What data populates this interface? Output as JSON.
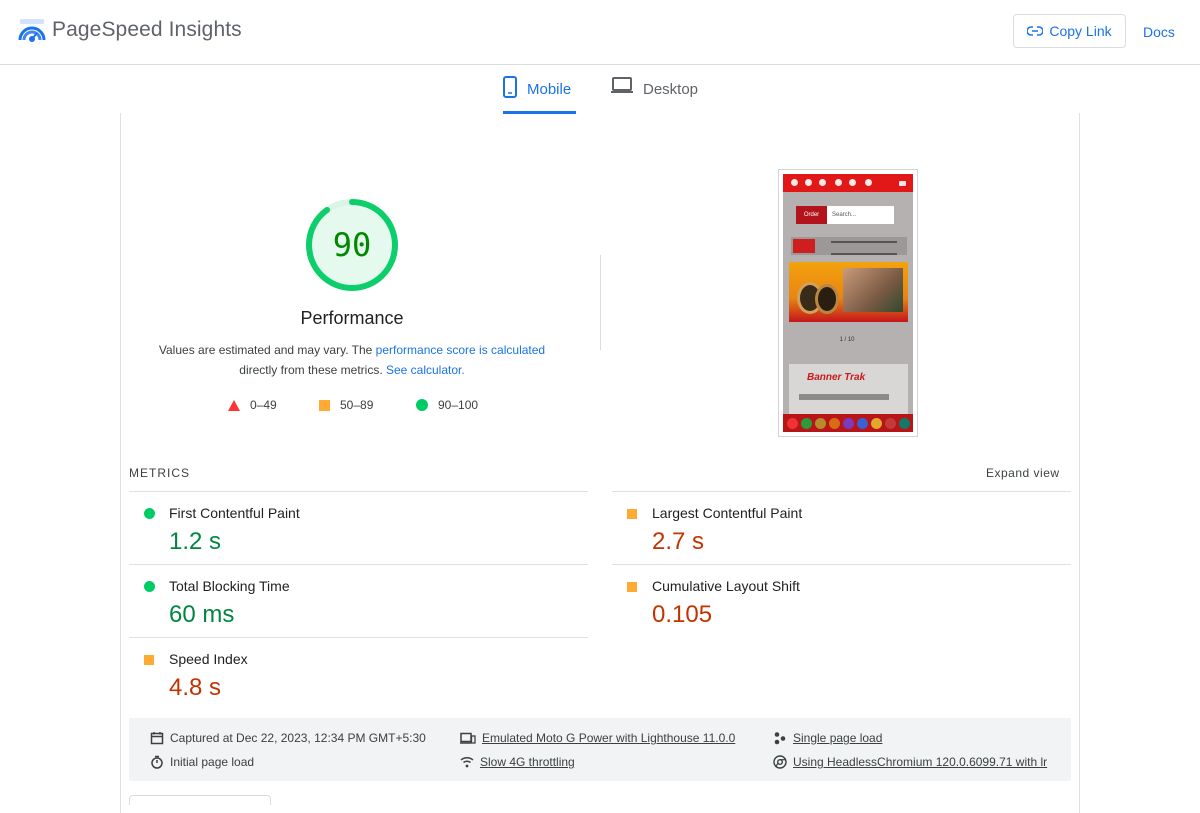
{
  "header": {
    "app_title": "PageSpeed Insights",
    "copy_link_label": "Copy Link",
    "docs_label": "Docs"
  },
  "tabs": [
    {
      "label": "Mobile",
      "selected": true
    },
    {
      "label": "Desktop",
      "selected": false
    }
  ],
  "performance": {
    "score": "90",
    "title": "Performance",
    "desc_prefix": "Values are estimated and may vary. The ",
    "desc_link1": "performance score is calculated",
    "desc_middle": "directly from these metrics. ",
    "desc_link2": "See calculator.",
    "legend": [
      {
        "range": "0–49",
        "shape": "triangle",
        "color": "#ff3333"
      },
      {
        "range": "50–89",
        "shape": "square",
        "color": "#ffaa33"
      },
      {
        "range": "90–100",
        "shape": "circle",
        "color": "#00cc66"
      }
    ]
  },
  "screenshot": {
    "order_label": "Order",
    "search_placeholder": "Search...",
    "pager": "1 / 10",
    "banner_text": "Banner Trak"
  },
  "metrics": {
    "label": "METRICS",
    "expand_label": "Expand view",
    "items": [
      {
        "name": "First Contentful Paint",
        "value": "1.2 s",
        "status": "good"
      },
      {
        "name": "Largest Contentful Paint",
        "value": "2.7 s",
        "status": "average"
      },
      {
        "name": "Total Blocking Time",
        "value": "60 ms",
        "status": "good"
      },
      {
        "name": "Cumulative Layout Shift",
        "value": "0.105",
        "status": "average"
      },
      {
        "name": "Speed Index",
        "value": "4.8 s",
        "status": "average"
      }
    ]
  },
  "run_info": {
    "captured": "Captured at Dec 22, 2023, 12:34 PM GMT+5:30",
    "initial_load": "Initial page load",
    "device": "Emulated Moto G Power with Lighthouse 11.0.0",
    "throttling": "Slow 4G throttling",
    "single_load": "Single page load",
    "browser": "Using HeadlessChromium 120.0.6099.71 with lr"
  },
  "colors": {
    "accent": "#1a73e8",
    "good": "#018642",
    "average": "#c33300",
    "gauge_good": "#0cce6b"
  }
}
